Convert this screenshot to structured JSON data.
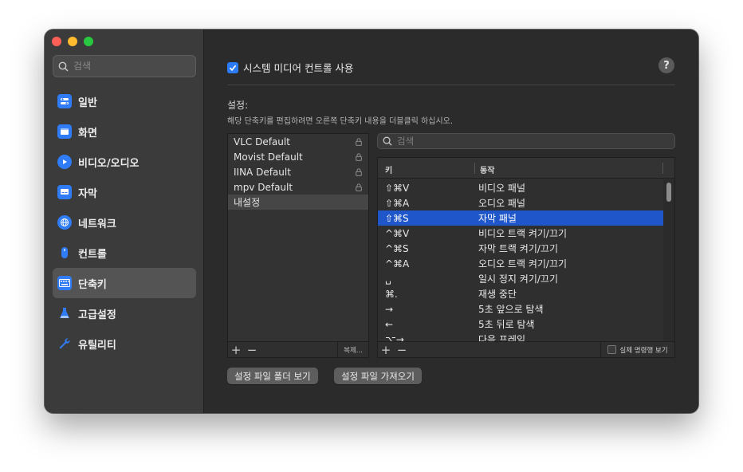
{
  "sidebar": {
    "search_placeholder": "검색",
    "items": [
      {
        "label": "일반",
        "icon": "toggle-icon",
        "color": "#2f7cf6"
      },
      {
        "label": "화면",
        "icon": "display-icon",
        "color": "#2f7cf6"
      },
      {
        "label": "비디오/오디오",
        "icon": "play-circle-icon",
        "color": "#2f7cf6"
      },
      {
        "label": "자막",
        "icon": "subtitle-icon",
        "color": "#2f7cf6"
      },
      {
        "label": "네트워크",
        "icon": "globe-icon",
        "color": "#2f7cf6"
      },
      {
        "label": "컨트롤",
        "icon": "mouse-icon",
        "color": "#2f7cf6"
      },
      {
        "label": "단축키",
        "icon": "keyboard-icon",
        "color": "#2f7cf6",
        "selected": true
      },
      {
        "label": "고급설정",
        "icon": "flask-icon",
        "color": "#2f7cf6"
      },
      {
        "label": "유틸리티",
        "icon": "wrench-icon",
        "color": "#2f7cf6"
      }
    ]
  },
  "main": {
    "media_control_label": "시스템 미디어 컨트롤 사용",
    "help_label": "?",
    "settings_title": "설정:",
    "settings_desc": "해당 단축키를 편집하려면 오른쪽 단축키 내용을 더블클릭 하십시오.",
    "presets": [
      {
        "name": "VLC Default",
        "locked": true
      },
      {
        "name": "Movist Default",
        "locked": true
      },
      {
        "name": "IINA Default",
        "locked": true
      },
      {
        "name": "mpv Default",
        "locked": true
      },
      {
        "name": "내설정",
        "locked": false,
        "selected": true
      }
    ],
    "preset_footer": {
      "add": "+",
      "remove": "−",
      "duplicate": "복제..."
    },
    "key_search_placeholder": "검색",
    "table": {
      "col_key": "키",
      "col_action": "동작",
      "rows": [
        {
          "key": "⇧⌘V",
          "action": "비디오 패널"
        },
        {
          "key": "⇧⌘A",
          "action": "오디오 패널"
        },
        {
          "key": "⇧⌘S",
          "action": "자막 패널",
          "selected": true
        },
        {
          "key": "^⌘V",
          "action": " 비디오 트랙 켜기/끄기"
        },
        {
          "key": "^⌘S",
          "action": " 자막 트랙 켜기/끄기"
        },
        {
          "key": "^⌘A",
          "action": " 오디오 트랙 켜기/끄기"
        },
        {
          "key": "␣",
          "action": " 일시 정지 켜기/끄기"
        },
        {
          "key": "⌘.",
          "action": "재생 중단"
        },
        {
          "key": "→",
          "action": " 5초  앞으로 탐색"
        },
        {
          "key": "←",
          "action": " 5초  뒤로 탐색"
        },
        {
          "key": "⌥→",
          "action": "다음 프레임"
        }
      ]
    },
    "table_footer": {
      "add": "+",
      "remove": "−",
      "raw_label": "실제 명령행 보기"
    },
    "buttons": {
      "open_folder": "설정 파일 폴더 보기",
      "import": "설정 파일 가져오기"
    }
  },
  "colors": {
    "accent": "#2c7bf6",
    "selection": "#1f56c9"
  }
}
